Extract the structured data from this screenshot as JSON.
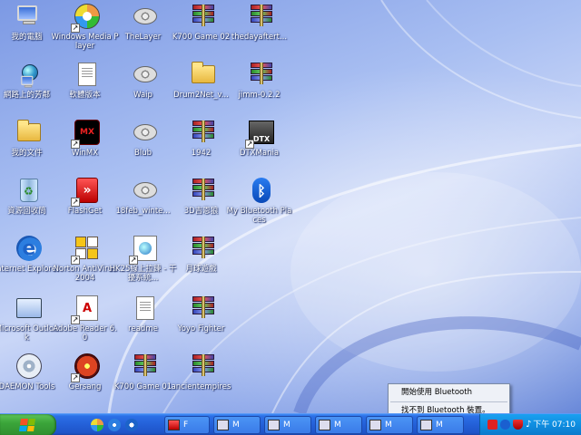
{
  "desktop": {
    "icons": [
      {
        "label": "我的電腦"
      },
      {
        "label": "網路上的芳鄰"
      },
      {
        "label": "我的文件"
      },
      {
        "label": "資源回收筒"
      },
      {
        "label": "Internet Explorer"
      },
      {
        "label": "Microsoft Outlook"
      },
      {
        "label": "DAEMON Tools"
      },
      {
        "label": "Windows Media Player"
      },
      {
        "label": "軟體版本"
      },
      {
        "label": "WinMX"
      },
      {
        "label": "FlashGet"
      },
      {
        "label": "Norton AntiVirus 2004"
      },
      {
        "label": "Adobe Reader 6.0"
      },
      {
        "label": "Gersang"
      },
      {
        "label": "TheLayer"
      },
      {
        "label": "Waip"
      },
      {
        "label": "Blub"
      },
      {
        "label": "18feb_winte..."
      },
      {
        "label": "HK25線上拉鍊 - 干擾系統..."
      },
      {
        "label": "readme"
      },
      {
        "label": "K700 Game 01"
      },
      {
        "label": "K700 Game 02"
      },
      {
        "label": "Drum2Net_v..."
      },
      {
        "label": "1942"
      },
      {
        "label": "3D吉恩狼"
      },
      {
        "label": "月球遊戲"
      },
      {
        "label": "Yoyo Fighter"
      },
      {
        "label": "ancientempires"
      },
      {
        "label": "thedayaftert..."
      },
      {
        "label": "jimm-0.2.2"
      },
      {
        "label": "DTXMania"
      },
      {
        "label": "My Bluetooth Places"
      }
    ]
  },
  "context_menu": {
    "items": [
      "開始使用 Bluetooth",
      "找不到 Bluetooth 裝置。"
    ]
  },
  "taskbar": {
    "start_label": "",
    "buttons": [
      {
        "label": "F"
      },
      {
        "label": "M"
      },
      {
        "label": "M"
      },
      {
        "label": "M"
      },
      {
        "label": "M"
      },
      {
        "label": "M"
      }
    ],
    "clock": "下午 07:10"
  }
}
